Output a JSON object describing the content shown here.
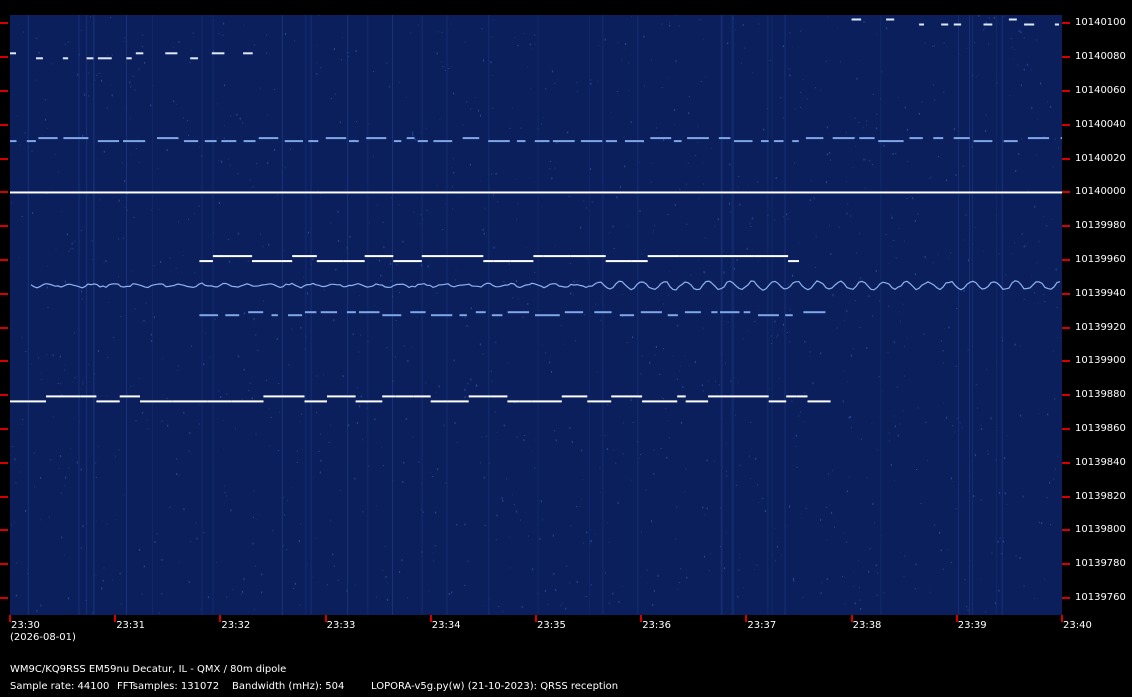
{
  "date_label": "(2026-08-01)",
  "station_line": "WM9C/KQ9RSS EM59nu Decatur, IL - QMX / 80m dipole",
  "sample_rate": "Sample rate: 44100",
  "fft_samples": "FFTsamples: 131072",
  "bandwidth": "Bandwidth (mHz): 504",
  "software": "LOPORA-v5g.py(w) (21-10-2023): QRSS reception",
  "colors": {
    "background": "#0a1f5c",
    "tick": "#d40000",
    "signal": "#ffffff"
  },
  "chart_data": {
    "type": "heatmap",
    "x_ticks": [
      "23:30",
      "23:31",
      "23:32",
      "23:33",
      "23:34",
      "23:35",
      "23:36",
      "23:37",
      "23:38",
      "23:39",
      "23:40"
    ],
    "y_ticks": [
      "10140100",
      "10140080",
      "10140060",
      "10140040",
      "10140020",
      "10140000",
      "10139980",
      "10139960",
      "10139940",
      "10139920",
      "10139900",
      "10139880",
      "10139860",
      "10139840",
      "10139820",
      "10139800",
      "10139780",
      "10139760"
    ],
    "y_range": [
      10139750,
      10140105
    ],
    "signals": [
      {
        "freq": 10140000,
        "start": "23:30",
        "end": "23:40",
        "kind": "carrier"
      },
      {
        "freq": 10139960,
        "start": "23:31.8",
        "end": "23:37.5",
        "kind": "fsk-dashes"
      },
      {
        "freq": 10139945,
        "start": "23:30.2",
        "end": "23:40",
        "kind": "wavy"
      },
      {
        "freq": 10139928,
        "start": "23:31.8",
        "end": "23:37.8",
        "kind": "dim-dashes"
      },
      {
        "freq": 10139877,
        "start": "23:30",
        "end": "23:37.8",
        "kind": "fsk-dashes"
      },
      {
        "freq": 10140080,
        "start": "23:30",
        "end": "23:32.5",
        "kind": "dots"
      },
      {
        "freq": 10140031,
        "start": "23:30",
        "end": "23:40",
        "kind": "dim-dashes"
      },
      {
        "freq": 10140100,
        "start": "23:38",
        "end": "23:40",
        "kind": "dots"
      }
    ]
  }
}
